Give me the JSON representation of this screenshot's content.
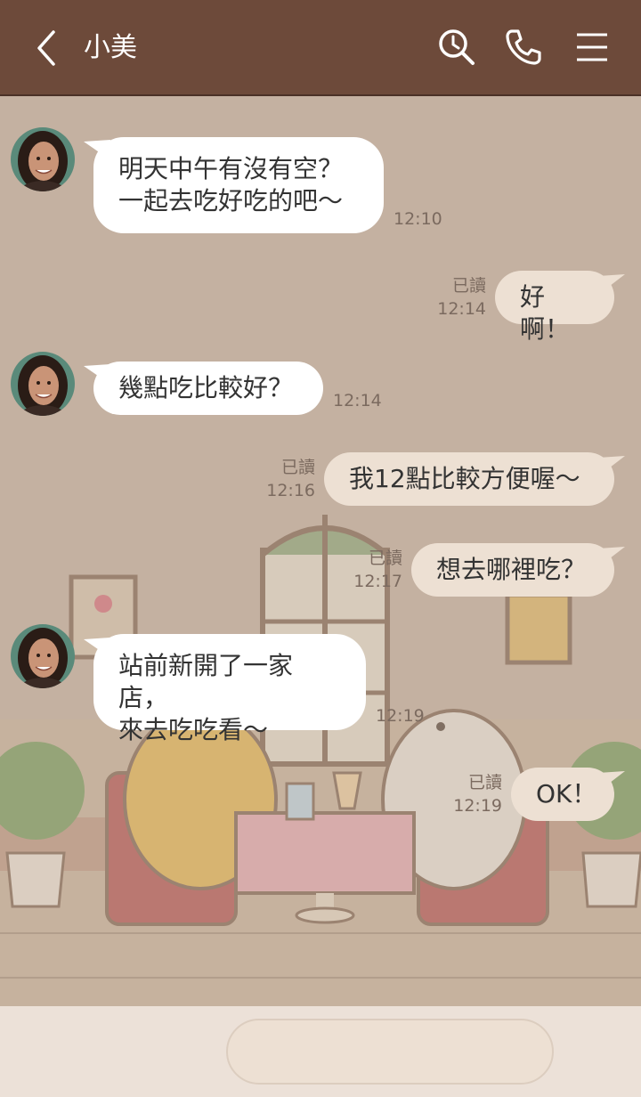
{
  "header": {
    "title": "小美",
    "icons": [
      "back-icon",
      "search-icon",
      "phone-icon",
      "menu-icon"
    ],
    "background": "#6d4a3a"
  },
  "messages": [
    {
      "side": "in",
      "lines": [
        "明天中午有沒有空？",
        "一起去吃好吃的吧～"
      ],
      "time": "12:10"
    },
    {
      "side": "out",
      "lines": [
        "好啊！"
      ],
      "read": "已讀",
      "time": "12:14"
    },
    {
      "side": "in",
      "lines": [
        "幾點吃比較好？"
      ],
      "time": "12:14"
    },
    {
      "side": "out",
      "lines": [
        "我12點比較方便喔～"
      ],
      "read": "已讀",
      "time": "12:16"
    },
    {
      "side": "out",
      "lines": [
        "想去哪裡吃？"
      ],
      "read": "已讀",
      "time": "12:17"
    },
    {
      "side": "in",
      "lines": [
        "站前新開了一家店，",
        "來去吃吃看～"
      ],
      "time": "12:19"
    },
    {
      "side": "out",
      "lines": [
        "OK！"
      ],
      "read": "已讀",
      "time": "12:19"
    }
  ],
  "footer": {
    "icons": [
      "plus-icon",
      "camera-icon",
      "image-icon",
      "emoji-icon",
      "microphone-icon"
    ],
    "input_value": ""
  },
  "colors": {
    "chat_bg": "#c4b1a1",
    "incoming_bubble": "#ffffff",
    "outgoing_bubble": "#ede0d3",
    "footer_bg": "#ece1d8"
  }
}
